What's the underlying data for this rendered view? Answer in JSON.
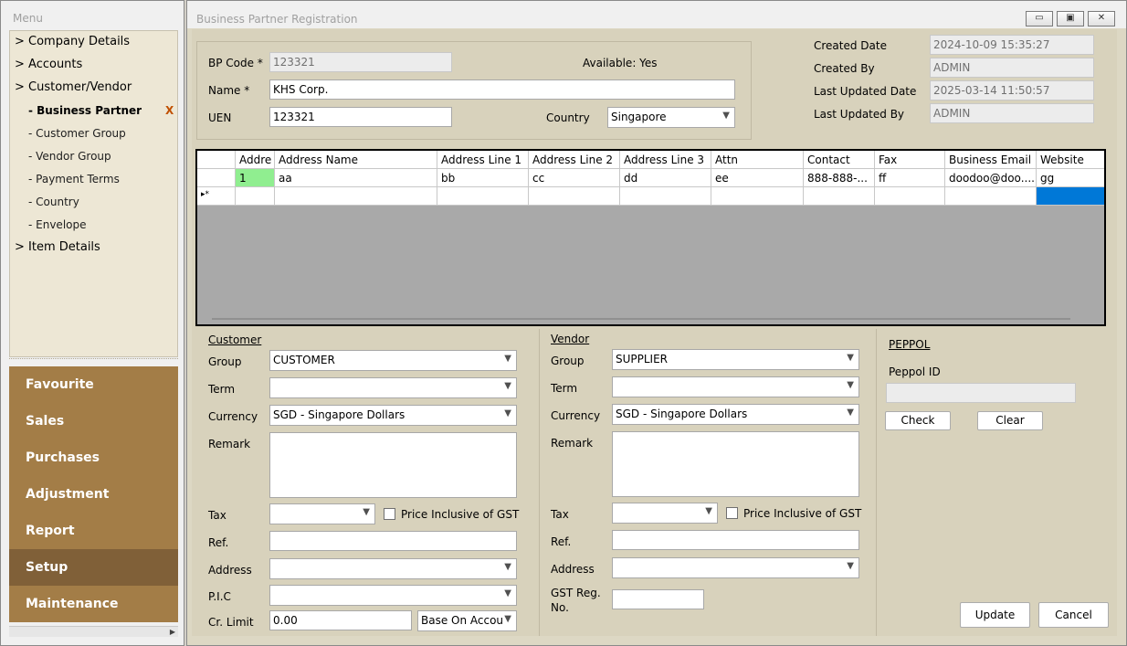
{
  "menu": {
    "title": "Menu",
    "tree": [
      {
        "label": "> Company Details"
      },
      {
        "label": "> Accounts"
      },
      {
        "label": "> Customer/Vendor"
      },
      {
        "label": "- Business Partner"
      },
      {
        "label": "- Customer Group"
      },
      {
        "label": "- Vendor Group"
      },
      {
        "label": "- Payment Terms"
      },
      {
        "label": "- Country"
      },
      {
        "label": "- Envelope"
      },
      {
        "label": "> Item Details"
      }
    ],
    "close_mark": "X",
    "modules": [
      "Favourite",
      "Sales",
      "Purchases",
      "Adjustment",
      "Report",
      "Setup",
      "Maintenance"
    ],
    "active_module": "Setup"
  },
  "window": {
    "title": "Business Partner Registration",
    "minimize": "▭",
    "maximize": "▣",
    "close": "✕"
  },
  "header": {
    "bp_code_label": "BP Code *",
    "bp_code": "123321",
    "available": "Available: Yes",
    "name_label": "Name *",
    "name": "KHS Corp.",
    "uen_label": "UEN",
    "uen": "123321",
    "country_label": "Country",
    "country": "Singapore",
    "created_date_label": "Created Date",
    "created_date": "2024-10-09 15:35:27",
    "created_by_label": "Created By",
    "created_by": "ADMIN",
    "last_updated_date_label": "Last Updated Date",
    "last_updated_date": "2025-03-14 11:50:57",
    "last_updated_by_label": "Last Updated By",
    "last_updated_by": "ADMIN"
  },
  "grid": {
    "columns": [
      "Addre",
      "Address Name",
      "Address Line 1",
      "Address Line 2",
      "Address Line 3",
      "Attn",
      "Contact",
      "Fax",
      "Business Email",
      "Website"
    ],
    "rows": [
      [
        "1",
        "aa",
        "bb",
        "cc",
        "dd",
        "ee",
        "888-888-...",
        "ff",
        "doodoo@doo....",
        "gg"
      ]
    ],
    "new_row_marker": "▸*"
  },
  "customer": {
    "title": "Customer",
    "group_label": "Group",
    "group": "CUSTOMER",
    "term_label": "Term",
    "term": "",
    "currency_label": "Currency",
    "currency": "SGD - Singapore Dollars",
    "remark_label": "Remark",
    "tax_label": "Tax",
    "price_incl_label": "Price Inclusive of GST",
    "ref_label": "Ref.",
    "address_label": "Address",
    "pic_label": "P.I.C",
    "cr_limit_label": "Cr. Limit",
    "cr_limit": "0.00",
    "cr_limit_basis": "Base On Accou"
  },
  "vendor": {
    "title": "Vendor",
    "group_label": "Group",
    "group": "SUPPLIER",
    "term_label": "Term",
    "currency_label": "Currency",
    "currency": "SGD - Singapore Dollars",
    "remark_label": "Remark",
    "tax_label": "Tax",
    "price_incl_label": "Price Inclusive of GST",
    "ref_label": "Ref.",
    "address_label": "Address",
    "gst_label_1": "GST Reg.",
    "gst_label_2": "No."
  },
  "peppol": {
    "title": "PEPPOL",
    "id_label": "Peppol ID",
    "check": "Check",
    "clear": "Clear"
  },
  "actions": {
    "update": "Update",
    "cancel": "Cancel"
  },
  "colors": {
    "module_bg": "#a37d47",
    "module_active": "#806038",
    "selected_cell": "#0078d7",
    "first_cell": "#90ee90"
  }
}
